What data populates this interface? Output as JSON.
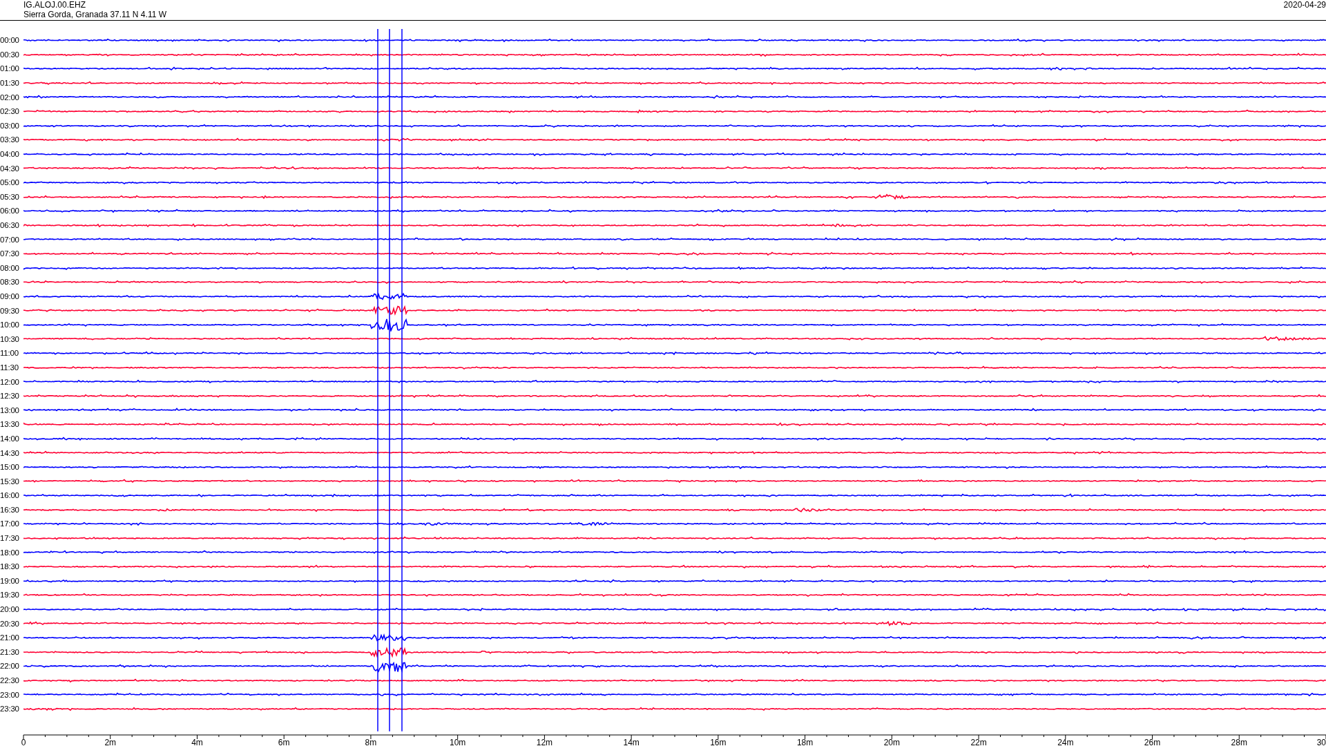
{
  "header": {
    "station": "IG.ALOJ.00.EHZ",
    "location": "Sierra Gorda, Granada  37.11 N 4.11 W",
    "date": "2020-04-29"
  },
  "rows": [
    {
      "label": "00:00",
      "color": "#0000ff"
    },
    {
      "label": "00:30",
      "color": "#ff0033"
    },
    {
      "label": "01:00",
      "color": "#0000ff"
    },
    {
      "label": "01:30",
      "color": "#ff0033"
    },
    {
      "label": "02:00",
      "color": "#0000ff"
    },
    {
      "label": "02:30",
      "color": "#ff0033"
    },
    {
      "label": "03:00",
      "color": "#0000ff"
    },
    {
      "label": "03:30",
      "color": "#ff0033"
    },
    {
      "label": "04:00",
      "color": "#0000ff"
    },
    {
      "label": "04:30",
      "color": "#ff0033"
    },
    {
      "label": "05:00",
      "color": "#0000ff"
    },
    {
      "label": "05:30",
      "color": "#ff0033"
    },
    {
      "label": "06:00",
      "color": "#0000ff"
    },
    {
      "label": "06:30",
      "color": "#ff0033"
    },
    {
      "label": "07:00",
      "color": "#0000ff"
    },
    {
      "label": "07:30",
      "color": "#ff0033"
    },
    {
      "label": "08:00",
      "color": "#0000ff"
    },
    {
      "label": "08:30",
      "color": "#ff0033"
    },
    {
      "label": "09:00",
      "color": "#0000ff"
    },
    {
      "label": "09:30",
      "color": "#ff0033"
    },
    {
      "label": "10:00",
      "color": "#0000ff"
    },
    {
      "label": "10:30",
      "color": "#ff0033"
    },
    {
      "label": "11:00",
      "color": "#0000ff"
    },
    {
      "label": "11:30",
      "color": "#ff0033"
    },
    {
      "label": "12:00",
      "color": "#0000ff"
    },
    {
      "label": "12:30",
      "color": "#ff0033"
    },
    {
      "label": "13:00",
      "color": "#0000ff"
    },
    {
      "label": "13:30",
      "color": "#ff0033"
    },
    {
      "label": "14:00",
      "color": "#0000ff"
    },
    {
      "label": "14:30",
      "color": "#ff0033"
    },
    {
      "label": "15:00",
      "color": "#0000ff"
    },
    {
      "label": "15:30",
      "color": "#ff0033"
    },
    {
      "label": "16:00",
      "color": "#0000ff"
    },
    {
      "label": "16:30",
      "color": "#ff0033"
    },
    {
      "label": "17:00",
      "color": "#0000ff"
    },
    {
      "label": "17:30",
      "color": "#ff0033"
    },
    {
      "label": "18:00",
      "color": "#0000ff"
    },
    {
      "label": "18:30",
      "color": "#ff0033"
    },
    {
      "label": "19:00",
      "color": "#0000ff"
    },
    {
      "label": "19:30",
      "color": "#ff0033"
    },
    {
      "label": "20:00",
      "color": "#0000ff"
    },
    {
      "label": "20:30",
      "color": "#ff0033"
    },
    {
      "label": "21:00",
      "color": "#0000ff"
    },
    {
      "label": "21:30",
      "color": "#ff0033"
    },
    {
      "label": "22:00",
      "color": "#0000ff"
    },
    {
      "label": "22:30",
      "color": "#ff0033"
    },
    {
      "label": "23:00",
      "color": "#0000ff"
    },
    {
      "label": "23:30",
      "color": "#ff0033"
    }
  ],
  "x_axis": {
    "ticks": [
      "0",
      "2m",
      "4m",
      "6m",
      "8m",
      "10m",
      "12m",
      "14m",
      "16m",
      "18m",
      "20m",
      "22m",
      "24m",
      "26m",
      "28m",
      "30"
    ]
  }
}
